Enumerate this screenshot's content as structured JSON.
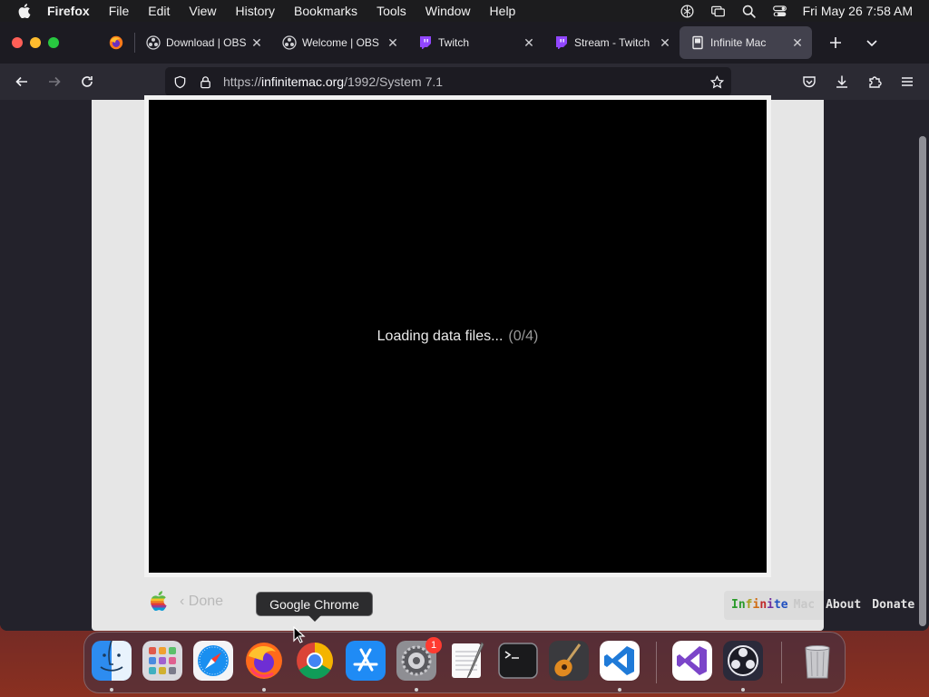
{
  "menubar": {
    "app_name": "Firefox",
    "menus": [
      "File",
      "Edit",
      "View",
      "History",
      "Bookmarks",
      "Tools",
      "Window",
      "Help"
    ],
    "clock": "Fri May 26  7:58 AM",
    "status_icons": [
      "openai-icon",
      "screen-mirroring-icon",
      "search-icon",
      "control-center-icon"
    ]
  },
  "tabs": [
    {
      "label": "Download | OBS",
      "icon": "obs-icon"
    },
    {
      "label": "Welcome | OBS",
      "icon": "obs-icon"
    },
    {
      "label": "Twitch",
      "icon": "twitch-icon"
    },
    {
      "label": "Stream - Twitch",
      "icon": "twitch-icon"
    },
    {
      "label": "Infinite Mac",
      "icon": "mac-icon",
      "active": true
    }
  ],
  "urlbar": {
    "scheme": "https://",
    "host": "infinitemac.org",
    "path": "/1992/System 7.1"
  },
  "page": {
    "loading_text": "Loading data files...",
    "loading_progress": "(0/4)",
    "done_label": "‹ Done",
    "brand_letters": [
      "I",
      "n",
      "f",
      "i",
      "n",
      "i",
      "t",
      "e"
    ],
    "brand_mac": "Mac",
    "about_label": "About",
    "donate_label": "Donate"
  },
  "dock": {
    "tooltip": "Google Chrome",
    "apps": [
      "Finder",
      "Launchpad",
      "Safari",
      "Firefox",
      "Google Chrome",
      "App Store",
      "System Settings",
      "TextEdit",
      "Terminal",
      "GarageBand",
      "Visual Studio Code",
      "Visual Studio",
      "OBS",
      "Trash"
    ],
    "settings_badge": "1"
  },
  "colors": {
    "menubar": "#1c1c1e",
    "tabbar": "#1c1b22",
    "navbar": "#2b2a33",
    "active_tab": "#42414d",
    "bezel": "#e6e6e6",
    "screen": "#000000"
  }
}
